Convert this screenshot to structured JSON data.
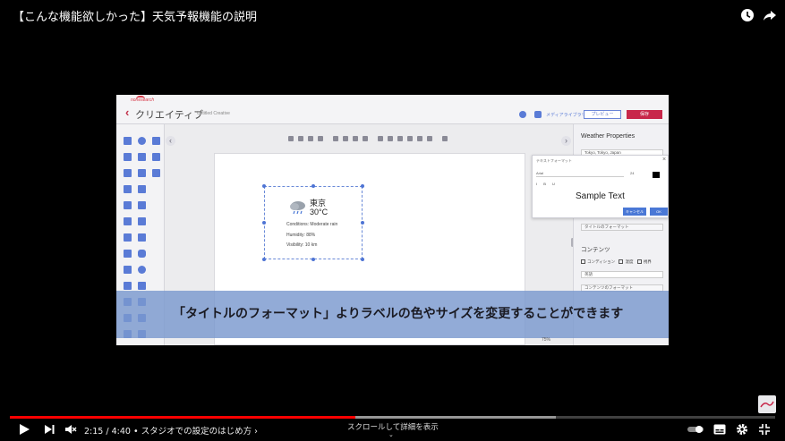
{
  "video": {
    "title": "【こんな機能欲しかった】天気予報機能の説明",
    "caption": "「タイトルのフォーマット」よりラベルの色やサイズを変更することができます"
  },
  "app": {
    "logo": "nonesearch",
    "title": "クリエイティブ",
    "document_name": "Untitled Creative",
    "media_library": "メディアライブラリ",
    "preview_button": "プレビュー",
    "save_button": "保存"
  },
  "weather_widget": {
    "city": "東京",
    "temperature": "30°C",
    "conditions": "Conditions: Moderate rain",
    "humidity": "Humidity: 88%",
    "visibility": "Visibility: 10 km"
  },
  "right_panel": {
    "title": "Weather Properties",
    "location": "Tokyo, Tokyo, Japan",
    "title_format_button": "タイトルのフォーマット",
    "content_section": "コンテンツ",
    "checks": [
      "コンディション",
      "湿度",
      "視界"
    ],
    "select_value": "英語",
    "content_format_button": "コンテンツのフォーマット"
  },
  "text_format_dialog": {
    "title": "テキストフォーマット",
    "font": "Arial",
    "size": "24",
    "format_buttons": "I B U",
    "sample_text": "Sample Text",
    "cancel_label": "キャンセル",
    "ok_label": "OK"
  },
  "zoom": "75%",
  "player": {
    "time": "2:15 / 4:40",
    "chapter": "• スタジオでの設定のはじめ方 ›",
    "scroll_hint": "スクロールして詳細を表示",
    "progress_fraction": 0.451,
    "buffer_fraction": 0.713
  },
  "colors": {
    "accent_red": "#c8274a",
    "progress_red": "#ff0000",
    "caption_band": "#7a98ce",
    "link_blue": "#4a78d6"
  },
  "icons": [
    "clock-icon",
    "share-icon",
    "play-icon",
    "next-icon",
    "mute-icon",
    "autoplay-toggle-icon",
    "subtitles-icon",
    "settings-gear-icon",
    "exit-fullscreen-icon",
    "rain-cloud-icon",
    "back-arrow-icon",
    "close-icon"
  ]
}
